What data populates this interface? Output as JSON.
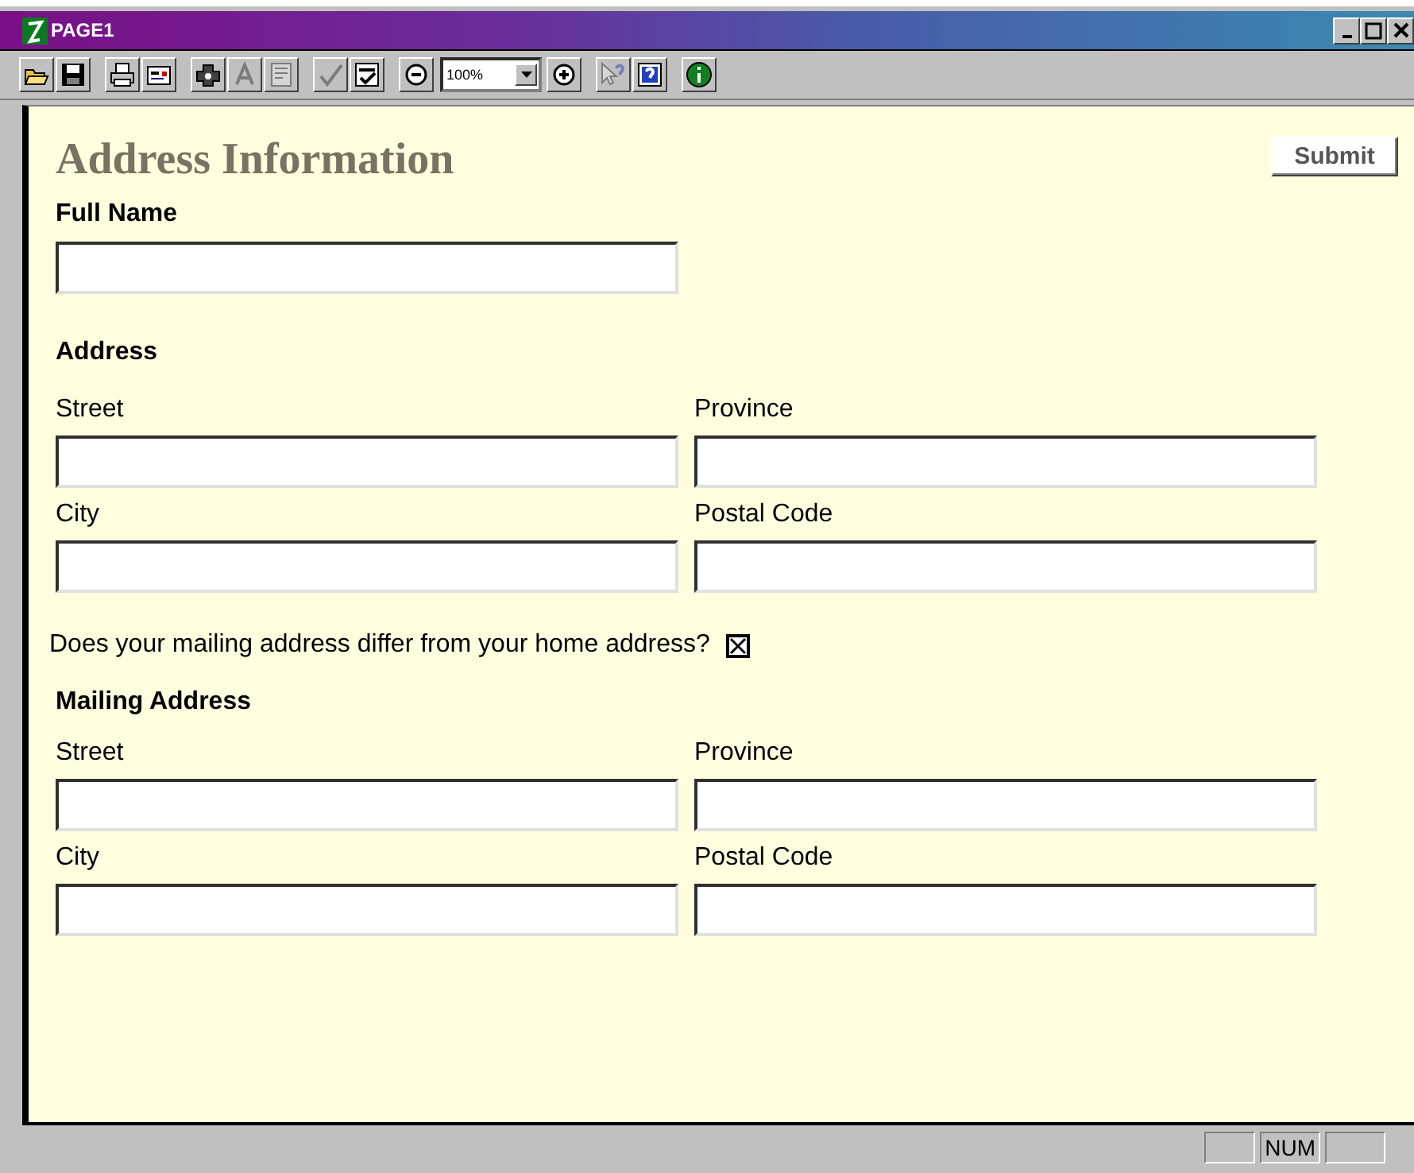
{
  "window": {
    "title": "PAGE1"
  },
  "toolbar": [
    {
      "kind": "open",
      "disabled": false
    },
    {
      "kind": "save",
      "disabled": false
    },
    {
      "kind": "separator"
    },
    {
      "kind": "print",
      "disabled": false
    },
    {
      "kind": "form",
      "disabled": false
    },
    {
      "kind": "separator"
    },
    {
      "kind": "plugin",
      "disabled": false
    },
    {
      "kind": "font",
      "disabled": true
    },
    {
      "kind": "paragraph",
      "disabled": true
    },
    {
      "kind": "separator"
    },
    {
      "kind": "spell",
      "disabled": true
    },
    {
      "kind": "validate",
      "disabled": false
    },
    {
      "kind": "separator"
    },
    {
      "kind": "zoom_out",
      "disabled": false
    },
    {
      "kind": "zoom",
      "value": "100%"
    },
    {
      "kind": "zoom_in",
      "disabled": false
    },
    {
      "kind": "separator"
    },
    {
      "kind": "whats_this",
      "disabled": true
    },
    {
      "kind": "help",
      "disabled": false
    },
    {
      "kind": "separator"
    },
    {
      "kind": "about",
      "disabled": false
    }
  ],
  "form": {
    "heading": "Address Information",
    "submit": "Submit",
    "full_name": {
      "label": "Full Name"
    },
    "address": {
      "heading": "Address",
      "fields": [
        {
          "label": "Street"
        },
        {
          "label": "Province"
        },
        {
          "label": "City"
        },
        {
          "label": "Postal Code"
        }
      ]
    },
    "question": {
      "text": "Does your mailing address differ from your home address?",
      "checked": true
    },
    "mailing_address": {
      "heading": "Mailing Address",
      "fields": [
        {
          "label": "Street"
        },
        {
          "label": "Province"
        },
        {
          "label": "City"
        },
        {
          "label": "Postal Code"
        }
      ]
    }
  },
  "status_bar": {
    "indicators": [
      "NUM"
    ]
  }
}
